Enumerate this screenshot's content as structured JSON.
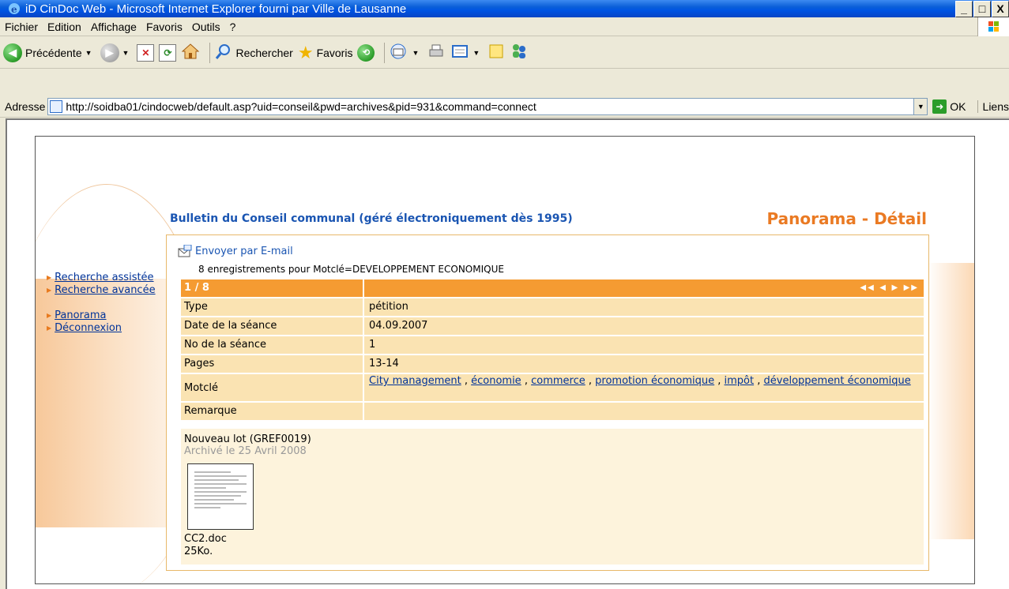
{
  "window": {
    "title": "iD CinDoc Web - Microsoft Internet Explorer fourni par Ville de Lausanne",
    "controls": {
      "minimize": "_",
      "maximize": "□",
      "close": "X"
    }
  },
  "menubar": {
    "items": [
      "Fichier",
      "Edition",
      "Affichage",
      "Favoris",
      "Outils",
      "?"
    ]
  },
  "toolbar": {
    "back_label": "Précédente",
    "search_label": "Rechercher",
    "favorites_label": "Favoris"
  },
  "addressbar": {
    "label": "Adresse",
    "url": "http://soidba01/cindocweb/default.asp?uid=conseil&pwd=archives&pid=931&command=connect",
    "go_label": "OK",
    "links_label": "Liens"
  },
  "page": {
    "title": "Bulletin du Conseil communal (géré électroniquement dès 1995)",
    "heading": "Panorama - Détail",
    "nav": [
      "Recherche assistée",
      "Recherche avancée",
      "Panorama",
      "Déconnexion"
    ],
    "email_label": "Envoyer par E-mail",
    "count_text": "8 enregistrements pour Motclé=DEVELOPPEMENT ECONOMIQUE",
    "record_position": "1 / 8",
    "pager_symbols": "◀◀ ◀ ▶ ▶▶",
    "fields": [
      {
        "label": "Type",
        "value": "pétition"
      },
      {
        "label": "Date de la séance",
        "value": "04.09.2007"
      },
      {
        "label": "No de la séance",
        "value": "1"
      },
      {
        "label": "Pages",
        "value": "13-14"
      }
    ],
    "motcle_label": "Motclé",
    "keywords": [
      "City management",
      "économie",
      "commerce",
      "promotion économique",
      "impôt",
      "développement économique"
    ],
    "remarque_label": "Remarque",
    "attachment": {
      "lot": "Nouveau lot (GREF0019)",
      "archived": "Archivé le 25 Avril 2008",
      "filename": "CC2.doc",
      "filesize": "25Ko."
    }
  },
  "colors": {
    "accent_orange": "#f59b32",
    "row_fill": "#fae3b2",
    "title_blue": "#1a55b2",
    "heading_orange": "#ea7a23"
  }
}
